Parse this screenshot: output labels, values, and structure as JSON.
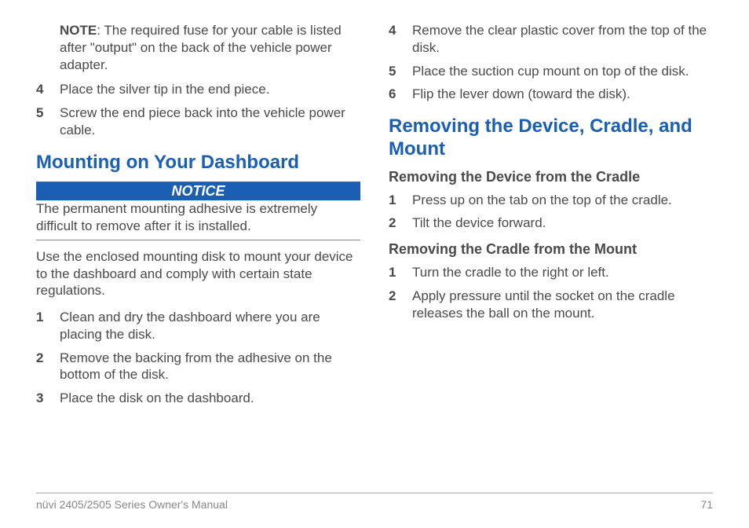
{
  "left": {
    "note": {
      "label": "NOTE",
      "text": ": The required fuse for your cable is listed after \"output\" on the back of the vehicle power adapter."
    },
    "steps_a": [
      {
        "n": "4",
        "t": "Place the silver tip in the end piece."
      },
      {
        "n": "5",
        "t": "Screw the end piece back into the vehicle power cable."
      }
    ],
    "heading1": "Mounting on Your Dashboard",
    "notice_label": "NOTICE",
    "notice_text": "The permanent mounting adhesive is extremely difficult to remove after it is installed.",
    "body1": "Use the enclosed mounting disk to mount your device to the dashboard and comply with certain state regulations.",
    "steps_b": [
      {
        "n": "1",
        "t": "Clean and dry the dashboard where you are placing the disk."
      },
      {
        "n": "2",
        "t": "Remove the backing from the adhesive on the bottom of the disk."
      },
      {
        "n": "3",
        "t": "Place the disk on the dashboard."
      }
    ]
  },
  "right": {
    "steps_c": [
      {
        "n": "4",
        "t": "Remove the clear plastic cover from the top of the disk."
      },
      {
        "n": "5",
        "t": "Place the suction cup mount on top of the disk."
      },
      {
        "n": "6",
        "t": "Flip the lever down (toward the disk)."
      }
    ],
    "heading2": "Removing the Device, Cradle, and Mount",
    "sub1": "Removing the Device from the Cradle",
    "steps_d": [
      {
        "n": "1",
        "t": "Press up on the tab on the top of the cradle."
      },
      {
        "n": "2",
        "t": "Tilt the device forward."
      }
    ],
    "sub2": "Removing the Cradle from the Mount",
    "steps_e": [
      {
        "n": "1",
        "t": "Turn the cradle to the right or left."
      },
      {
        "n": "2",
        "t": "Apply pressure until the socket on the cradle releases the ball on the mount."
      }
    ]
  },
  "footer": {
    "left": "nüvi 2405/2505 Series Owner's Manual",
    "right": "71"
  }
}
